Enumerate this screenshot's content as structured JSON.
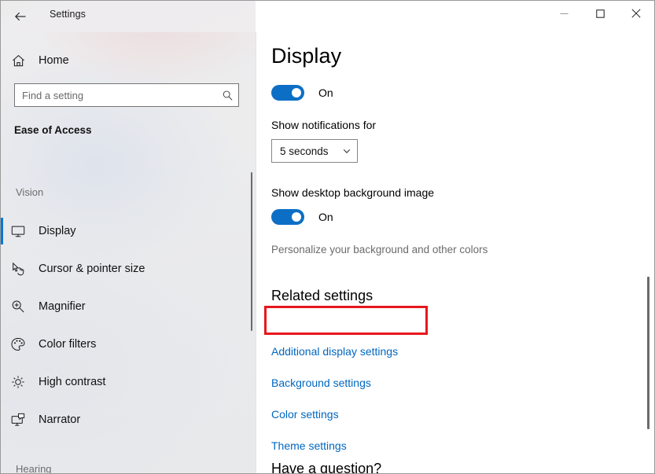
{
  "window": {
    "title": "Settings",
    "back_icon": "back-arrow-icon",
    "minimize_label": "─",
    "maximize_label": "□",
    "close_label": "✕"
  },
  "sidebar": {
    "home_label": "Home",
    "home_icon": "home-icon",
    "search": {
      "placeholder": "Find a setting",
      "value": "",
      "icon": "search-icon"
    },
    "section_title": "Ease of Access",
    "groups": [
      {
        "label": "Vision"
      },
      {
        "label": "Hearing"
      }
    ],
    "items": [
      {
        "label": "Display",
        "icon": "monitor-icon",
        "selected": true
      },
      {
        "label": "Cursor & pointer size",
        "icon": "cursor-pointer-icon",
        "selected": false
      },
      {
        "label": "Magnifier",
        "icon": "magnifier-icon",
        "selected": false
      },
      {
        "label": "Color filters",
        "icon": "color-palette-icon",
        "selected": false
      },
      {
        "label": "High contrast",
        "icon": "brightness-sun-icon",
        "selected": false
      },
      {
        "label": "Narrator",
        "icon": "narrator-screen-icon",
        "selected": false
      }
    ]
  },
  "main": {
    "page_title": "Display",
    "notifications_toggle": {
      "state_label": "On",
      "on": true
    },
    "notifications_duration": {
      "label": "Show notifications for",
      "selected_value": "5 seconds",
      "chevron_icon": "chevron-down-icon"
    },
    "desktop_background": {
      "label": "Show desktop background image",
      "state_label": "On",
      "on": true,
      "description": "Personalize your background and other colors"
    },
    "related_settings": {
      "heading": "Related settings",
      "links": [
        "Additional display settings",
        "Background settings",
        "Color settings",
        "Theme settings"
      ]
    },
    "question_heading": "Have a question?"
  },
  "colors": {
    "accent_blue": "#0078d7",
    "toggle_blue": "#0c6fc5",
    "link_blue": "#0067c0",
    "highlight_red": "#e8171c",
    "sidebar_bg": "#ebebed"
  }
}
